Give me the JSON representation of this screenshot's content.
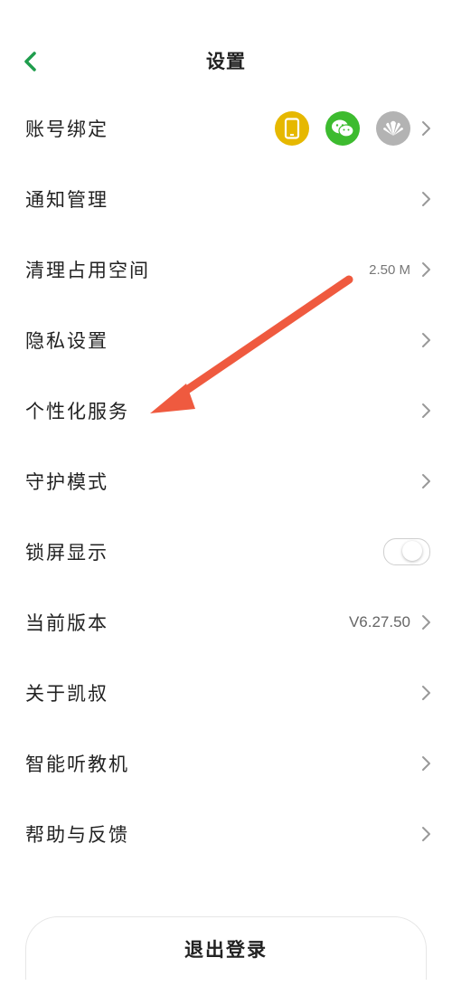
{
  "header": {
    "title": "设置"
  },
  "icons": {
    "back": "chevron-left-icon",
    "phone": "phone-icon",
    "wechat": "wechat-icon",
    "huawei": "huawei-icon",
    "chevron": "chevron-right-icon"
  },
  "colors": {
    "accent": "#1f9d4d",
    "phone_bg": "#e6b800",
    "wechat_bg": "#3dbb2f",
    "huawei_bg": "#b3b3b3",
    "arrow": "#ef5a3f"
  },
  "rows": [
    {
      "label": "账号绑定"
    },
    {
      "label": "通知管理"
    },
    {
      "label": "清理占用空间",
      "value": "2.50 M"
    },
    {
      "label": "隐私设置"
    },
    {
      "label": "个性化服务"
    },
    {
      "label": "守护模式"
    },
    {
      "label": "锁屏显示",
      "toggle_on": false
    },
    {
      "label": "当前版本",
      "value": "V6.27.50"
    },
    {
      "label": "关于凯叔"
    },
    {
      "label": "智能听教机"
    },
    {
      "label": "帮助与反馈"
    }
  ],
  "logout": {
    "label": "退出登录"
  }
}
